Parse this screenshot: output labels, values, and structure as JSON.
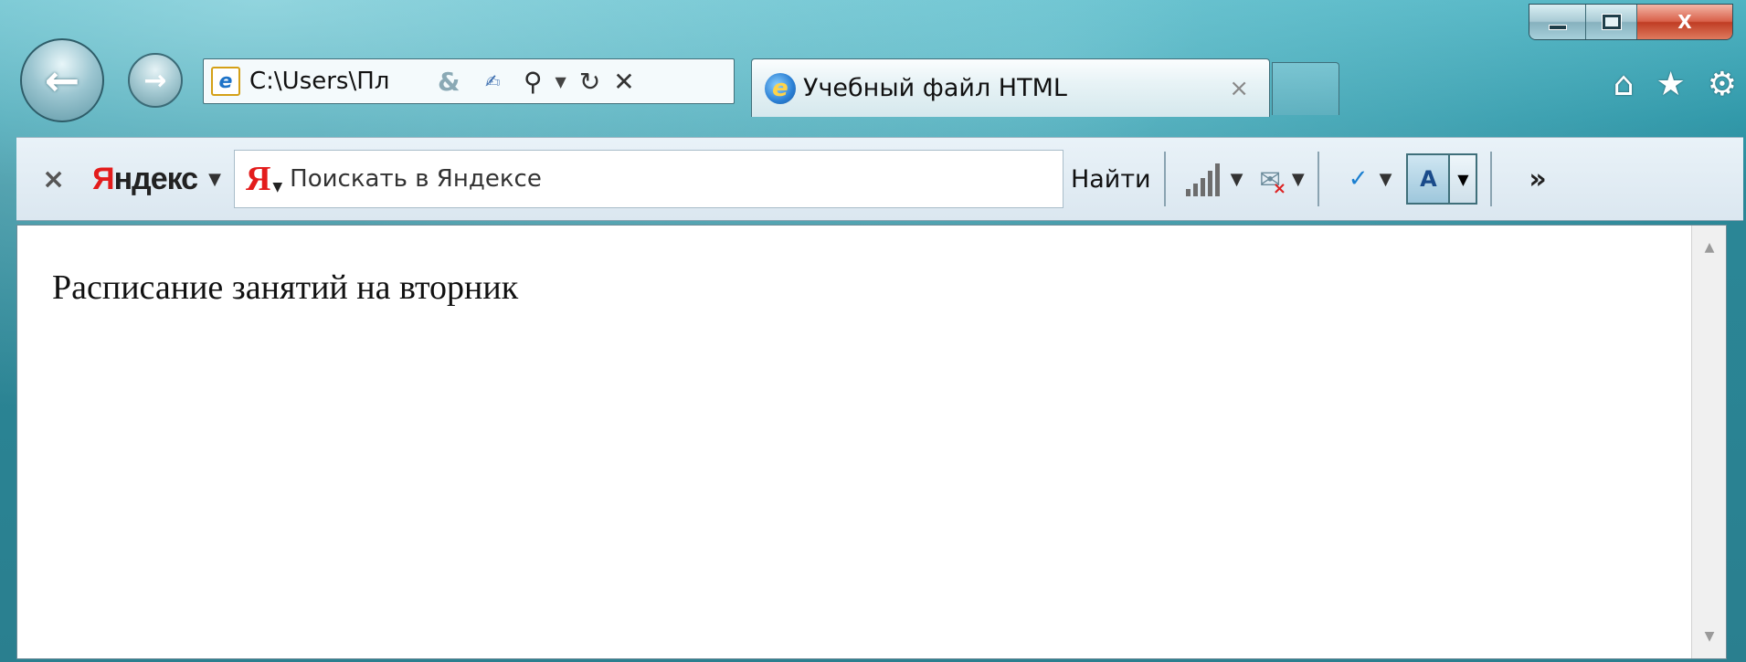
{
  "window": {
    "minimize_icon": "minimize-icon",
    "maximize_icon": "maximize-icon",
    "close_label": "X"
  },
  "nav": {
    "back_icon": "arrow-left-icon",
    "forward_icon": "arrow-right-icon",
    "address": "C:\\Users\\Пл",
    "address_icon": "e"
  },
  "tab": {
    "title": "Учебный файл HTML",
    "close": "×"
  },
  "toolbar": {
    "close": "×",
    "yandex_brand_letter": "Я",
    "yandex_brand_rest": "ндекс",
    "search_logo": "Я",
    "search_placeholder": "Поискать в Яндексе",
    "find_label": "Найти",
    "more_label": "»"
  },
  "content": {
    "text": "Расписание занятий на вторник"
  },
  "colors": {
    "frame": "#2b8797",
    "yandex_red": "#e31c1c",
    "close_red": "#c03d24"
  }
}
